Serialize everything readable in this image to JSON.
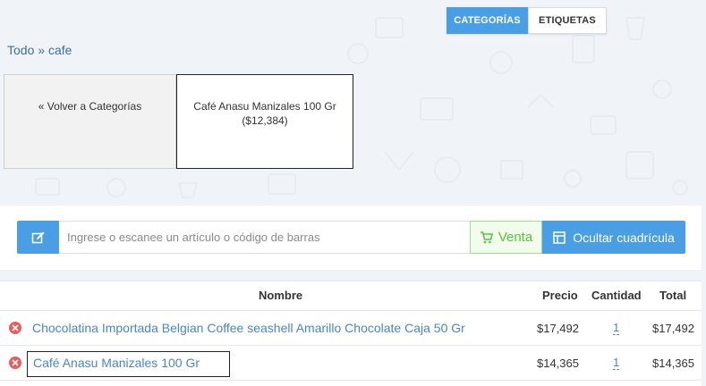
{
  "toggle": {
    "categories_label": "CATEGORÍAS",
    "tags_label": "ETIQUETAS"
  },
  "breadcrumb": {
    "root": "Todo",
    "separator": "»",
    "current": "cafe"
  },
  "tiles": {
    "back_label": "« Volver a Categorías",
    "product_name": "Café Anasu Manizales 100 Gr",
    "product_price": "($12,384)"
  },
  "search": {
    "placeholder": "Ingrese o escanee un artículo o código de barras",
    "value": ""
  },
  "buttons": {
    "venta_label": "Venta",
    "hide_grid_label": "Ocultar cuadrícula"
  },
  "icons": {
    "edit": "edit-icon",
    "cart": "cart-icon",
    "grid": "grid-icon",
    "remove": "remove-icon"
  },
  "colors": {
    "accent": "#4a9ee3",
    "venta_green": "#5cc13f",
    "remove_red": "#e4605e",
    "link_blue": "#4a86c5"
  },
  "table": {
    "headers": {
      "name": "Nombre",
      "price": "Precio",
      "quantity": "Cantidad",
      "total": "Total"
    },
    "rows": [
      {
        "name": "Chocolatina Importada Belgian Coffee seashell Amarillo Chocolate Caja 50 Gr",
        "price": "$17,492",
        "quantity": "1",
        "total": "$17,492"
      },
      {
        "name": "Café Anasu Manizales 100 Gr",
        "price": "$14,365",
        "quantity": "1",
        "total": "$14,365"
      }
    ]
  }
}
